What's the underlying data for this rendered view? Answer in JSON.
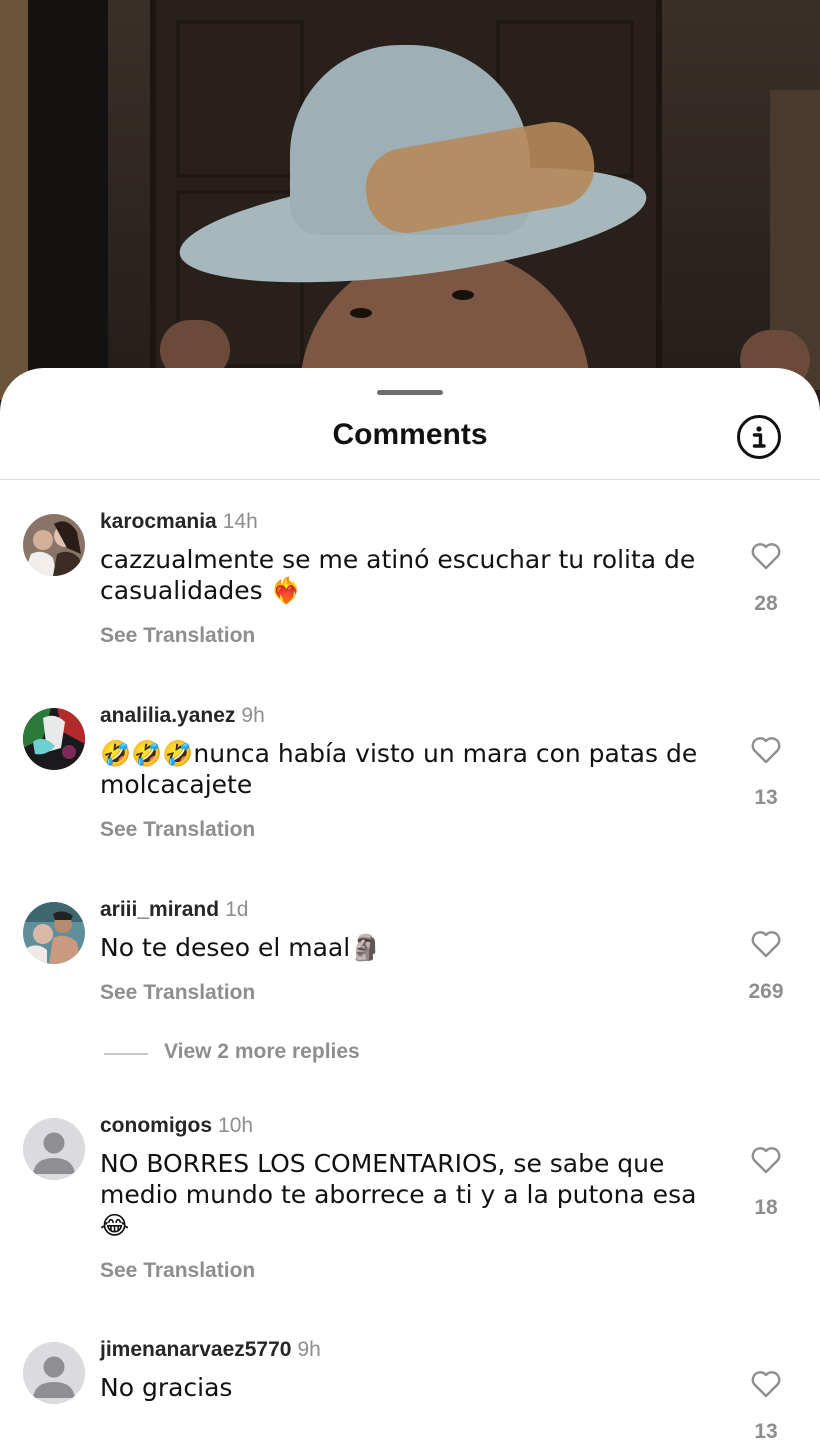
{
  "sheet": {
    "title": "Comments"
  },
  "comments": [
    {
      "username": "karocmania",
      "time": "14h",
      "text": "cazzualmente se me atinó escuchar tu rolita de casualidades ❤️‍🔥",
      "see_translation": "See Translation",
      "likes": "28"
    },
    {
      "username": "analilia.yanez",
      "time": "9h",
      "text": "🤣🤣🤣nunca había visto un mara con patas de molcacajete",
      "see_translation": "See Translation",
      "likes": "13"
    },
    {
      "username": "ariii_mirand",
      "time": "1d",
      "text": "No te deseo el maal🗿",
      "see_translation": "See Translation",
      "likes": "269",
      "view_replies": "View 2 more replies"
    },
    {
      "username": "conomigos",
      "time": "10h",
      "text": "NO BORRES LOS COMENTARIOS, se sabe que medio mundo te aborrece a ti y a la putona esa 😂",
      "see_translation": "See Translation",
      "likes": "18"
    },
    {
      "username": "jimenanarvaez5770",
      "time": "9h",
      "text": "No gracias",
      "likes": "13"
    }
  ],
  "icons": {
    "info": "info-circle-icon",
    "like": "heart-outline-icon",
    "avatar_default": "default-user-icon"
  }
}
